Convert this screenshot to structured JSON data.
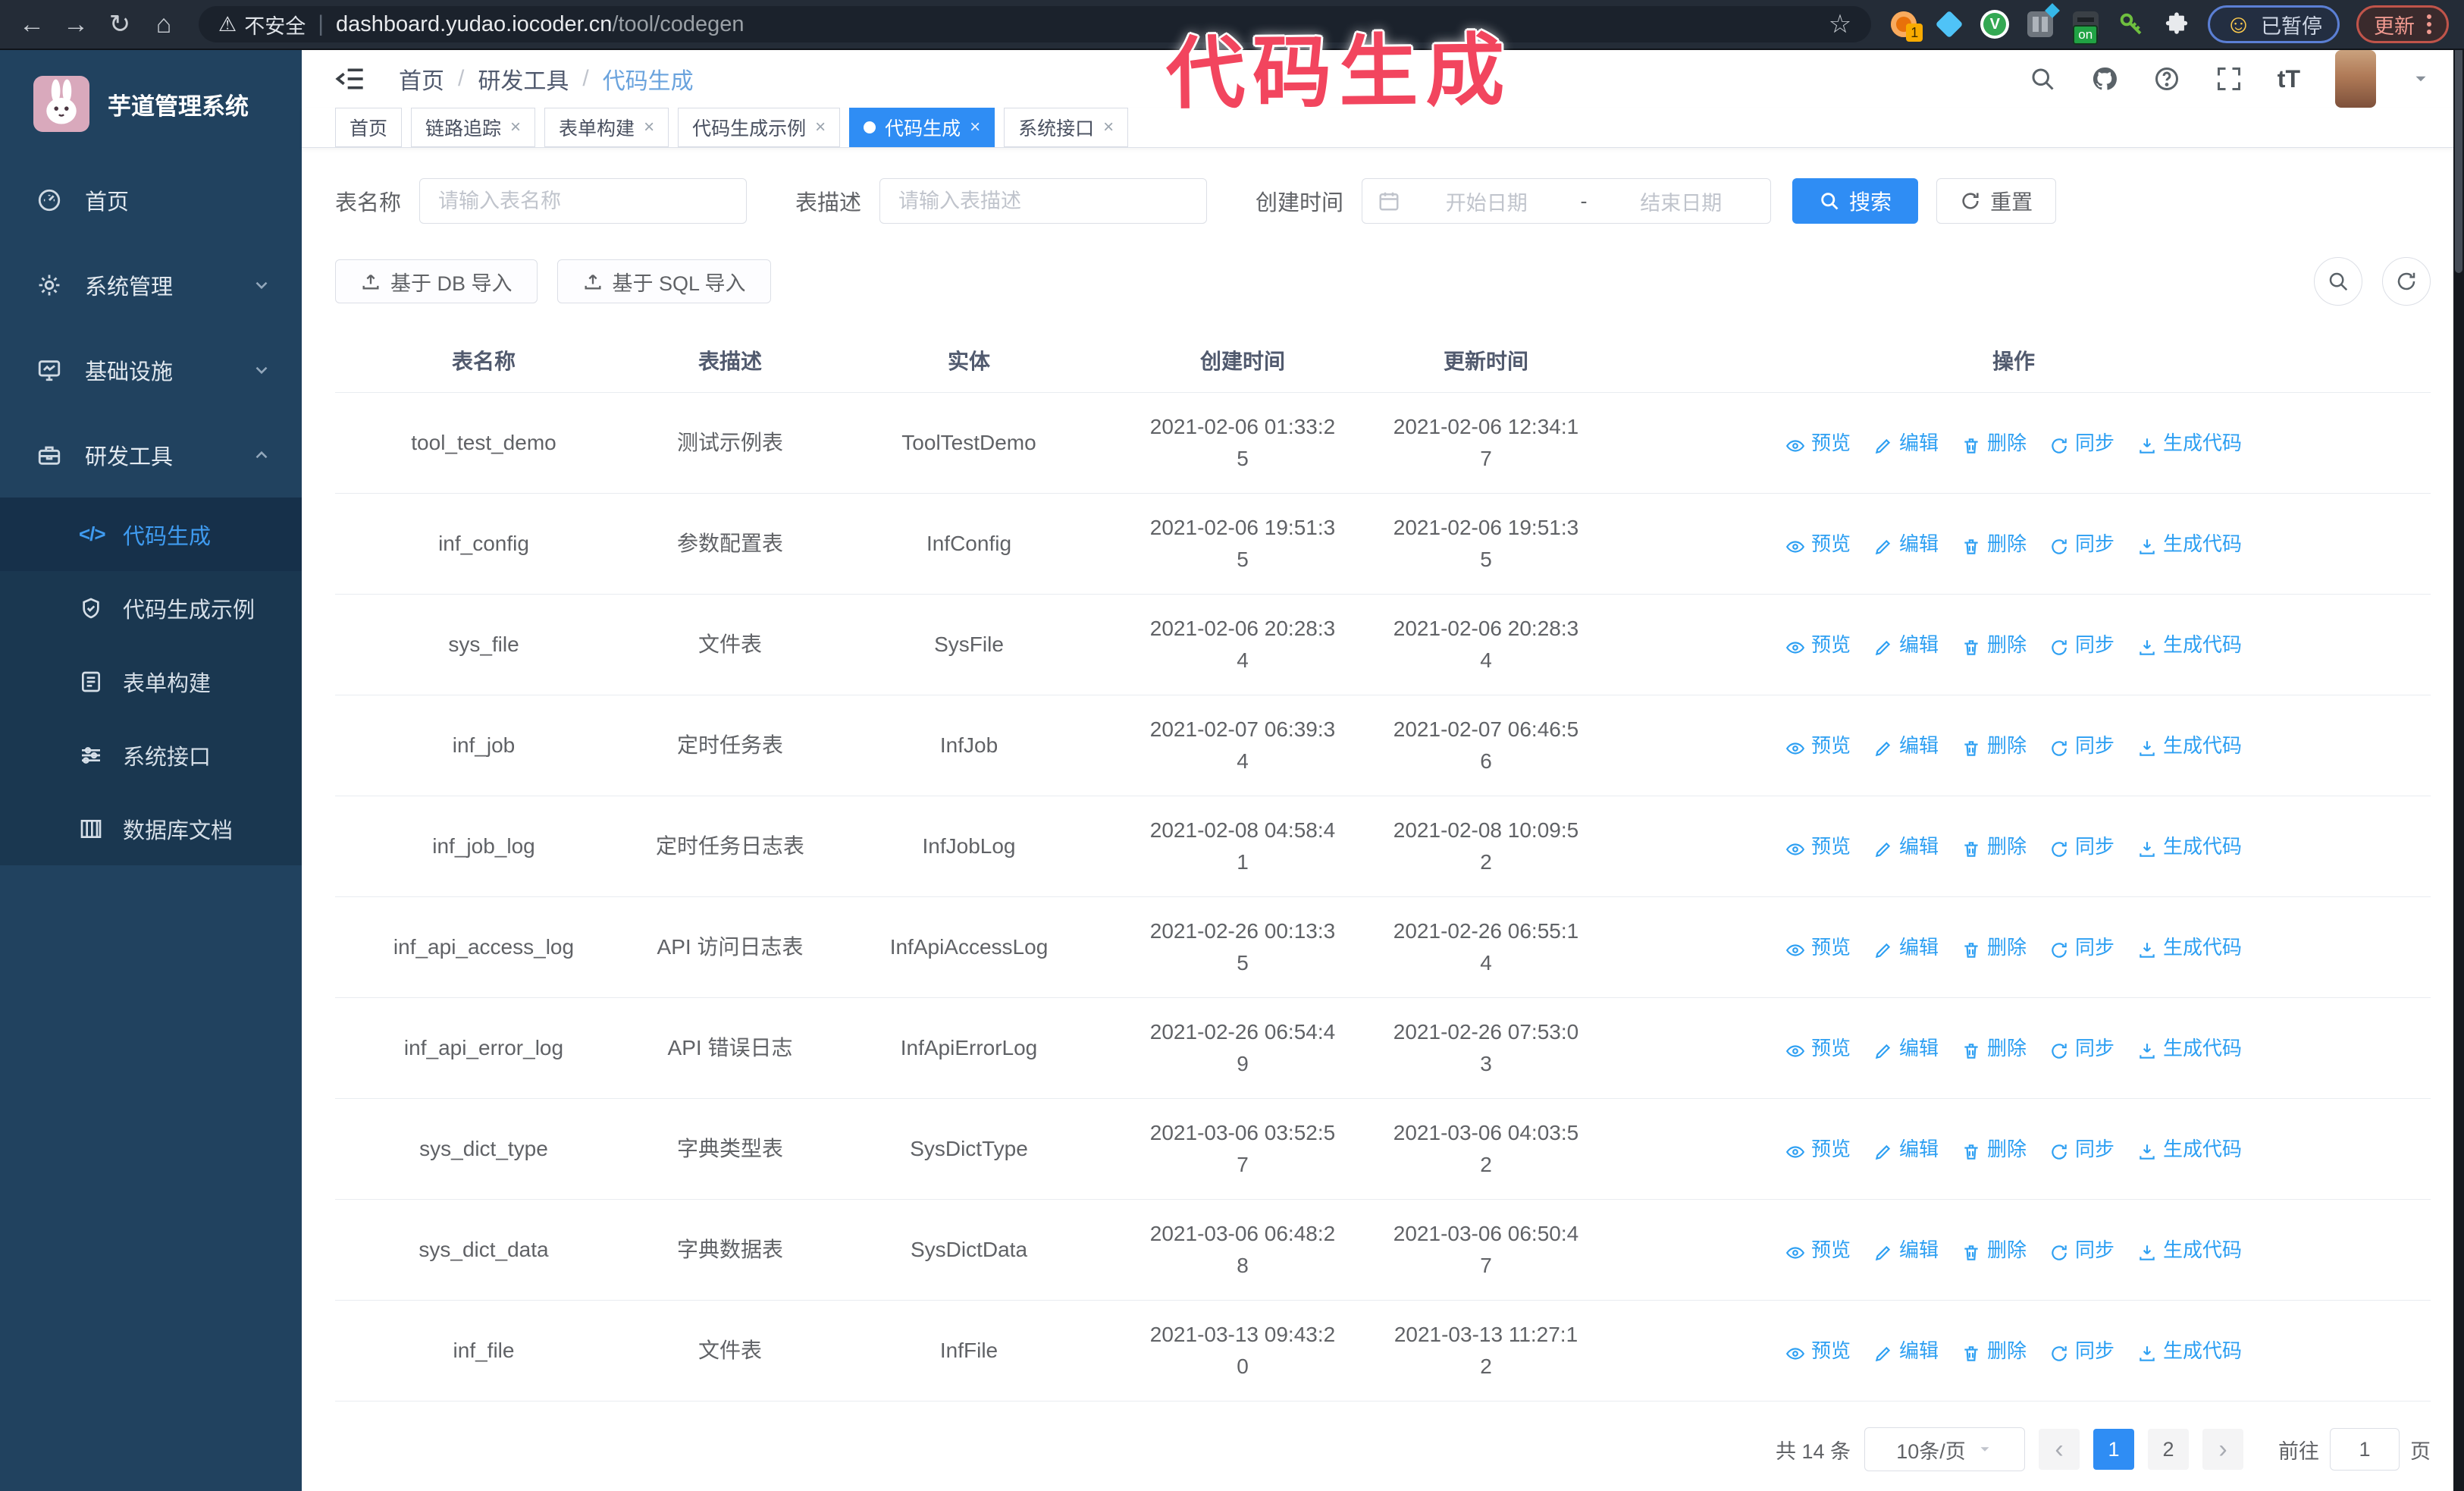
{
  "browser": {
    "security_label": "不安全",
    "url_host": "dashboard.yudao.iocoder.cn",
    "url_path": "/tool/codegen",
    "extension_badge": "1",
    "extension_on_badge": "on",
    "paused_label": "已暂停",
    "update_label": "更新"
  },
  "overlay": {
    "title": "代码生成",
    "color": "#f2455e"
  },
  "sidebar": {
    "app_title": "芋道管理系统",
    "items": [
      {
        "label": "首页",
        "icon": "dashboard-icon",
        "state": "none"
      },
      {
        "label": "系统管理",
        "icon": "gear-icon",
        "state": "collapsed"
      },
      {
        "label": "基础设施",
        "icon": "monitor-icon",
        "state": "collapsed"
      },
      {
        "label": "研发工具",
        "icon": "toolbox-icon",
        "state": "expanded"
      }
    ],
    "submenu": [
      {
        "label": "代码生成",
        "icon": "code-icon",
        "active": true
      },
      {
        "label": "代码生成示例",
        "icon": "shield-check-icon",
        "active": false
      },
      {
        "label": "表单构建",
        "icon": "form-icon",
        "active": false
      },
      {
        "label": "系统接口",
        "icon": "sliders-icon",
        "active": false
      },
      {
        "label": "数据库文档",
        "icon": "database-doc-icon",
        "active": false
      }
    ]
  },
  "header": {
    "breadcrumb": [
      "首页",
      "研发工具",
      "代码生成"
    ],
    "right_icons": [
      "search-icon",
      "github-icon",
      "question-icon",
      "fullscreen-icon",
      "font-size-icon",
      "avatar",
      "chevron-down-icon"
    ],
    "font_size_glyph": "tT"
  },
  "tabs": [
    {
      "label": "首页",
      "closable": false,
      "active": false
    },
    {
      "label": "链路追踪",
      "closable": true,
      "active": false
    },
    {
      "label": "表单构建",
      "closable": true,
      "active": false
    },
    {
      "label": "代码生成示例",
      "closable": true,
      "active": false
    },
    {
      "label": "代码生成",
      "closable": true,
      "active": true
    },
    {
      "label": "系统接口",
      "closable": true,
      "active": false
    }
  ],
  "filters": {
    "table_name_label": "表名称",
    "table_name_placeholder": "请输入表名称",
    "table_desc_label": "表描述",
    "table_desc_placeholder": "请输入表描述",
    "create_time_label": "创建时间",
    "start_date_placeholder": "开始日期",
    "range_separator": "-",
    "end_date_placeholder": "结束日期",
    "search_label": "搜索",
    "reset_label": "重置"
  },
  "toolbar": {
    "import_db_label": "基于 DB 导入",
    "import_sql_label": "基于 SQL 导入"
  },
  "table": {
    "columns": [
      "表名称",
      "表描述",
      "实体",
      "创建时间",
      "更新时间",
      "操作"
    ],
    "actions": [
      "预览",
      "编辑",
      "删除",
      "同步",
      "生成代码"
    ],
    "action_keys": [
      "preview",
      "edit",
      "delete",
      "sync",
      "generate-code"
    ],
    "action_icons": [
      "eye-icon",
      "edit-icon",
      "delete-icon",
      "sync-icon",
      "download-icon"
    ],
    "rows": [
      {
        "name": "tool_test_demo",
        "desc": "测试示例表",
        "entity": "ToolTestDemo",
        "created": "2021-02-06 01:33:25",
        "updated": "2021-02-06 12:34:17"
      },
      {
        "name": "inf_config",
        "desc": "参数配置表",
        "entity": "InfConfig",
        "created": "2021-02-06 19:51:35",
        "updated": "2021-02-06 19:51:35"
      },
      {
        "name": "sys_file",
        "desc": "文件表",
        "entity": "SysFile",
        "created": "2021-02-06 20:28:34",
        "updated": "2021-02-06 20:28:34"
      },
      {
        "name": "inf_job",
        "desc": "定时任务表",
        "entity": "InfJob",
        "created": "2021-02-07 06:39:34",
        "updated": "2021-02-07 06:46:56"
      },
      {
        "name": "inf_job_log",
        "desc": "定时任务日志表",
        "entity": "InfJobLog",
        "created": "2021-02-08 04:58:41",
        "updated": "2021-02-08 10:09:52"
      },
      {
        "name": "inf_api_access_log",
        "desc": "API 访问日志表",
        "entity": "InfApiAccessLog",
        "created": "2021-02-26 00:13:35",
        "updated": "2021-02-26 06:55:14"
      },
      {
        "name": "inf_api_error_log",
        "desc": "API 错误日志",
        "entity": "InfApiErrorLog",
        "created": "2021-02-26 06:54:49",
        "updated": "2021-02-26 07:53:03"
      },
      {
        "name": "sys_dict_type",
        "desc": "字典类型表",
        "entity": "SysDictType",
        "created": "2021-03-06 03:52:57",
        "updated": "2021-03-06 04:03:52"
      },
      {
        "name": "sys_dict_data",
        "desc": "字典数据表",
        "entity": "SysDictData",
        "created": "2021-03-06 06:48:28",
        "updated": "2021-03-06 06:50:47"
      },
      {
        "name": "inf_file",
        "desc": "文件表",
        "entity": "InfFile",
        "created": "2021-03-13 09:43:20",
        "updated": "2021-03-13 11:27:12"
      }
    ]
  },
  "pagination": {
    "total_label": "共 14 条",
    "page_size": "10条/页",
    "prev_glyph": "‹",
    "next_glyph": "›",
    "pages": [
      "1",
      "2"
    ],
    "active_page": "1",
    "goto_label": "前往",
    "goto_value": "1",
    "goto_suffix": "页"
  },
  "colors": {
    "accent_blue": "#2f8df4",
    "action_link": "#2d9ff2",
    "sidebar_bg": "#21425f",
    "submenu_bg": "#1a3750",
    "browser_bar_bg": "#242c37",
    "overlay_pink": "#f2455e"
  }
}
